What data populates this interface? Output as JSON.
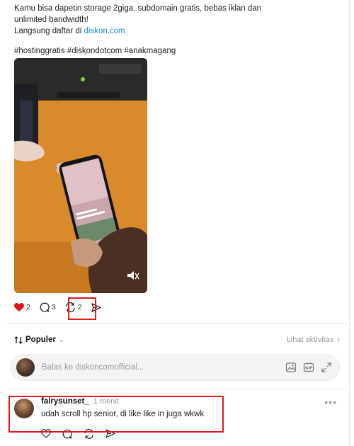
{
  "post": {
    "lines": [
      "Kamu bisa dapetin storage 2giga, subdomain gratis, bebas iklan dan",
      "unlimited bandwidth!"
    ],
    "signup_prefix": "Langsung daftar di ",
    "signup_link": "diskon.com",
    "hashtags": "#hostinggratis #diskondotcom #anakmagang"
  },
  "actions": {
    "likes": "2",
    "comments": "3",
    "reposts": "2"
  },
  "sort": {
    "label": "Populer",
    "activity_link": "Lihat aktivitas"
  },
  "reply": {
    "placeholder": "Balas ke diskoncomofficial..."
  },
  "comment": {
    "username": "fairysunset_",
    "time": "1 menit",
    "text": "udah scroll hp senior, di like like in juga wkwk",
    "more": "•••"
  },
  "colors": {
    "like_red": "#e0161b",
    "link_blue": "#1a8cd8",
    "highlight_red": "#e0161b"
  }
}
